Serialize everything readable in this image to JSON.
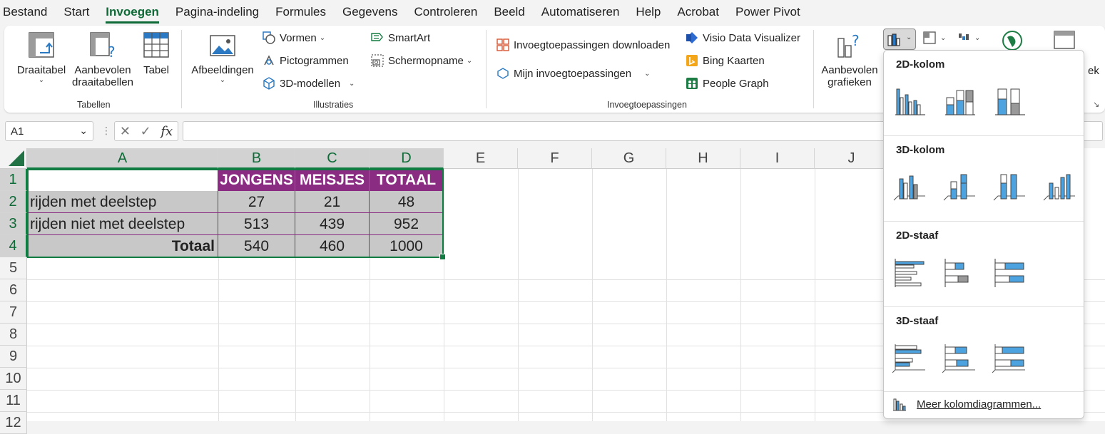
{
  "menu": [
    "Bestand",
    "Start",
    "Invoegen",
    "Pagina-indeling",
    "Formules",
    "Gegevens",
    "Controleren",
    "Beeld",
    "Automatiseren",
    "Help",
    "Acrobat",
    "Power Pivot"
  ],
  "ribbon": {
    "tabellen": {
      "group": "Tabellen",
      "draaitabel": "Draaitabel",
      "aanbevolen1": "Aanbevolen",
      "aanbevolen2": "draaitabellen",
      "tabel": "Tabel"
    },
    "illustraties": {
      "group": "Illustraties",
      "afbeeldingen": "Afbeeldingen",
      "vormen": "Vormen",
      "pictogrammen": "Pictogrammen",
      "modellen": "3D-modellen",
      "smartart": "SmartArt",
      "schermopname": "Schermopname"
    },
    "invoeg": {
      "group": "Invoegtoepassingen",
      "downloaden": "Invoegtoepassingen downloaden",
      "mijn": "Mijn invoegtoepassingen",
      "visio": "Visio Data Visualizer",
      "bing": "Bing Kaarten",
      "people": "People Graph"
    },
    "grafieken": {
      "aanbevolen1": "Aanbevolen",
      "aanbevolen2": "grafieken",
      "partial": "ek"
    }
  },
  "namebox": "A1",
  "fx": "fx",
  "columns": [
    "A",
    "B",
    "C",
    "D",
    "E",
    "F",
    "G",
    "H",
    "I",
    "J"
  ],
  "rows": [
    "1",
    "2",
    "3",
    "4",
    "5",
    "6",
    "7",
    "8",
    "9",
    "10",
    "11",
    "12"
  ],
  "table": {
    "headers": [
      "JONGENS",
      "MEISJES",
      "TOTAAL"
    ],
    "rows": [
      {
        "label": "rijden met deelstep",
        "values": [
          "27",
          "21",
          "48"
        ]
      },
      {
        "label": "rijden niet met deelstep",
        "values": [
          "513",
          "439",
          "952"
        ]
      },
      {
        "label": "Totaal",
        "values": [
          "540",
          "460",
          "1000"
        ]
      }
    ]
  },
  "dropdown": {
    "sections": [
      "2D-kolom",
      "3D-kolom",
      "2D-staaf",
      "3D-staaf"
    ],
    "more": "Meer kolomdiagrammen..."
  },
  "colors": {
    "accent": "#107c41",
    "header": "#8a2c82",
    "cellfill": "#c8c8c8",
    "chartblue": "#4da3e0"
  }
}
